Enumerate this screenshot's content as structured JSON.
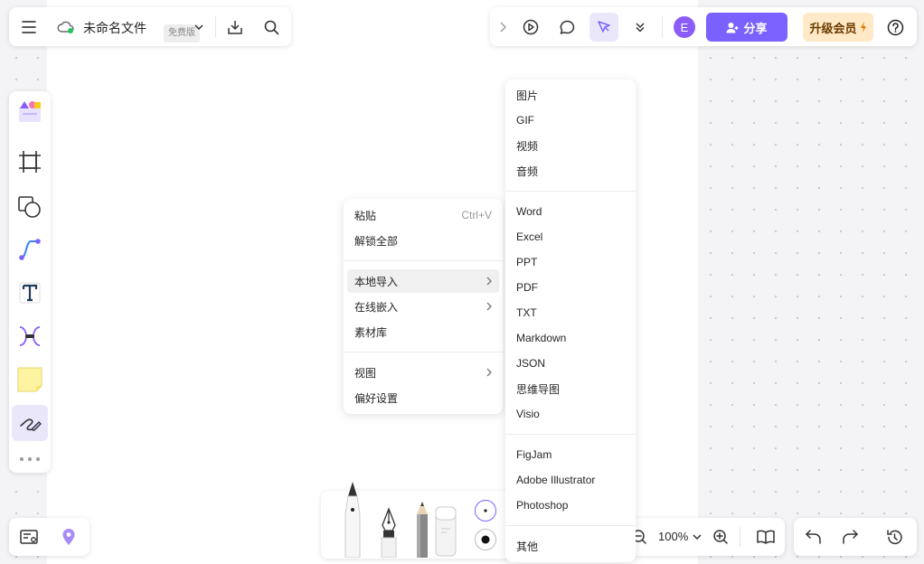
{
  "header": {
    "title": "未命名文件",
    "badge": "免费版",
    "avatar_letter": "E",
    "share_label": "分享",
    "upgrade_label": "升级会员"
  },
  "zoom": {
    "level": "100%"
  },
  "context_menu": {
    "items": [
      {
        "label": "粘贴",
        "shortcut": "Ctrl+V"
      },
      {
        "label": "解锁全部"
      },
      {
        "label": "本地导入",
        "submenu": true
      },
      {
        "label": "在线嵌入",
        "submenu": true
      },
      {
        "label": "素材库"
      },
      {
        "label": "视图",
        "submenu": true
      },
      {
        "label": "偏好设置"
      }
    ]
  },
  "import_submenu": {
    "items": [
      "图片",
      "GIF",
      "视频",
      "音频",
      "Word",
      "Excel",
      "PPT",
      "PDF",
      "TXT",
      "Markdown",
      "JSON",
      "思维导图",
      "Visio",
      "FigJam",
      "Adobe Illustrator",
      "Photoshop",
      "其他"
    ]
  },
  "colors": {
    "accent": "#7b61ff",
    "avatar": "#8b5cf6",
    "upgrade_bg": "#ffe9c6",
    "cloud_ok": "#22c55e"
  },
  "icons": {
    "menu": "hamburger-icon",
    "cloud": "cloud-saved-icon",
    "download": "download-icon",
    "search": "search-icon",
    "play": "play-icon",
    "comment": "comment-icon",
    "cursor": "select-cursor-icon",
    "more": "chevron-double-down-icon",
    "help": "help-icon",
    "undo": "undo-icon",
    "redo": "redo-icon",
    "history": "history-icon"
  }
}
